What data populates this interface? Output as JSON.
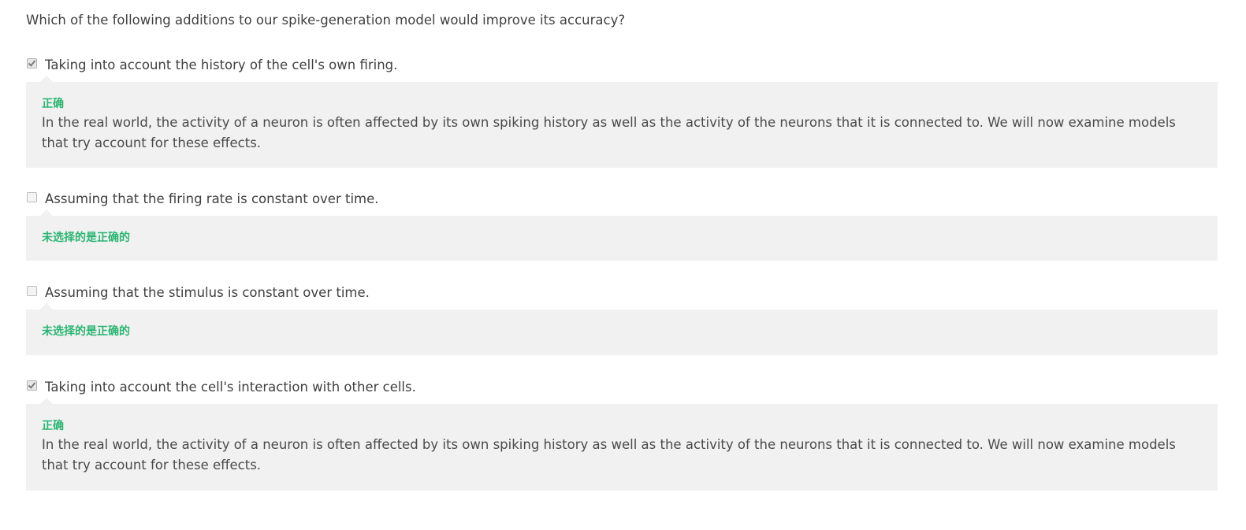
{
  "question": "Which of the following additions to our spike-generation model would improve its accuracy?",
  "options": [
    {
      "label": "Taking into account the history of the cell's own firing.",
      "checked": true,
      "status": "正确",
      "explanation": "In the real world, the activity of a neuron is often affected by its own spiking history as well as the activity of the neurons that it is connected to. We will now examine models that try account for these effects."
    },
    {
      "label": "Assuming that the firing rate is constant over time.",
      "checked": false,
      "status": "未选择的是正确的",
      "explanation": ""
    },
    {
      "label": "Assuming that the stimulus is constant over time.",
      "checked": false,
      "status": "未选择的是正确的",
      "explanation": ""
    },
    {
      "label": "Taking into account the cell's interaction with other cells.",
      "checked": true,
      "status": "正确",
      "explanation": "In the real world, the activity of a neuron is often affected by its own spiking history as well as the activity of the neurons that it is connected to. We will now examine models that try account for these effects."
    }
  ],
  "colors": {
    "correct_green": "#2bb673",
    "feedback_background": "#f1f1f1",
    "text": "#444444"
  }
}
